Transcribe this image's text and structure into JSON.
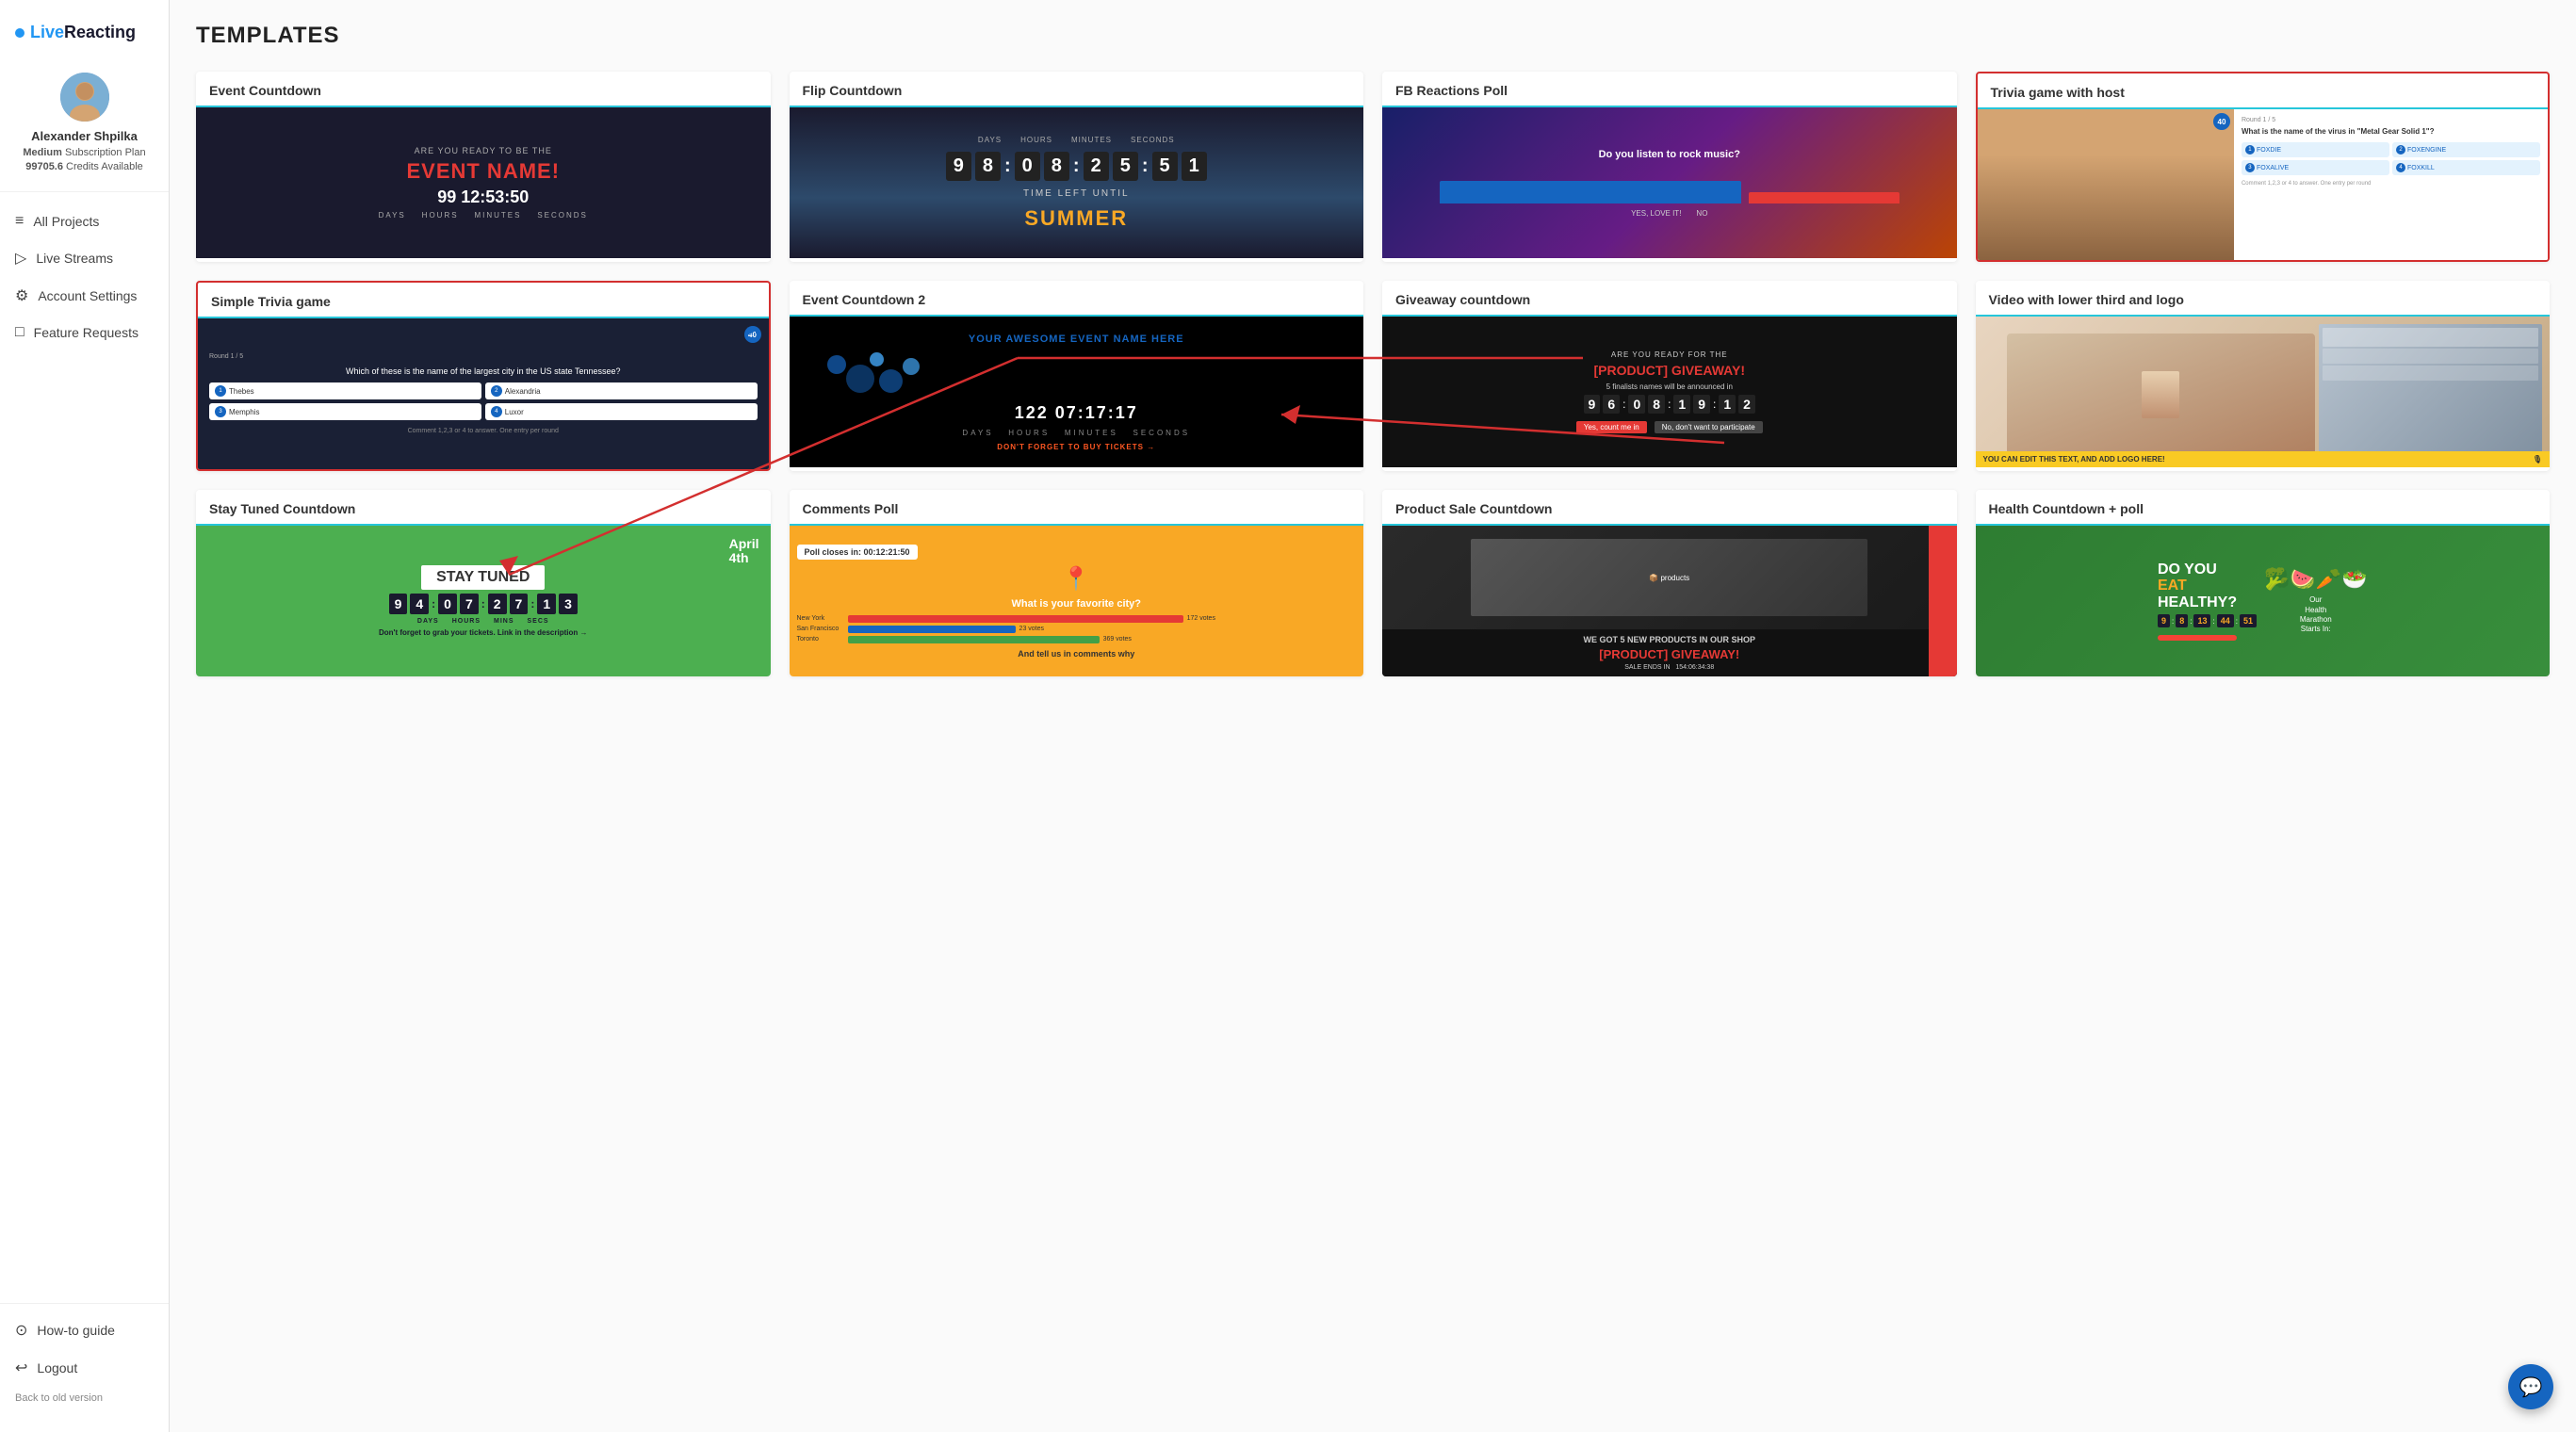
{
  "app": {
    "name": "LiveReacting",
    "logo_dot_color": "#2196f3"
  },
  "user": {
    "name": "Alexander Shpilka",
    "subscription_plan": "Medium",
    "subscription_label": "Subscription Plan",
    "credits": "99705.6",
    "credits_label": "Credits Available"
  },
  "sidebar": {
    "nav_items": [
      {
        "id": "all-projects",
        "label": "All Projects",
        "icon": "≡",
        "active": false
      },
      {
        "id": "live-streams",
        "label": "Live Streams",
        "icon": "▷",
        "active": false
      },
      {
        "id": "account-settings",
        "label": "Account Settings",
        "icon": "⚙",
        "active": false
      },
      {
        "id": "feature-requests",
        "label": "Feature Requests",
        "icon": "□",
        "active": false
      }
    ],
    "bottom_nav": [
      {
        "id": "how-to-guide",
        "label": "How-to guide",
        "icon": "?"
      },
      {
        "id": "logout",
        "label": "Logout",
        "icon": "↩"
      }
    ],
    "back_old_version": "Back to old version"
  },
  "page": {
    "title": "TEMPLATES"
  },
  "templates": [
    {
      "id": "event-countdown",
      "title": "Event Countdown",
      "highlighted": false,
      "preview_type": "event-countdown"
    },
    {
      "id": "flip-countdown",
      "title": "Flip Countdown",
      "highlighted": false,
      "preview_type": "flip-countdown"
    },
    {
      "id": "fb-reactions-poll",
      "title": "FB Reactions Poll",
      "highlighted": false,
      "preview_type": "fb-reactions"
    },
    {
      "id": "trivia-game-host",
      "title": "Trivia game with host",
      "highlighted": true,
      "preview_type": "trivia-host"
    },
    {
      "id": "simple-trivia-game",
      "title": "Simple Trivia game",
      "highlighted": true,
      "preview_type": "simple-trivia"
    },
    {
      "id": "event-countdown-2",
      "title": "Event Countdown 2",
      "highlighted": false,
      "preview_type": "event-countdown-2"
    },
    {
      "id": "giveaway-countdown",
      "title": "Giveaway countdown",
      "highlighted": false,
      "preview_type": "giveaway"
    },
    {
      "id": "video-lower-third",
      "title": "Video with lower third and logo",
      "highlighted": false,
      "preview_type": "video-lower"
    },
    {
      "id": "stay-tuned-countdown",
      "title": "Stay Tuned Countdown",
      "highlighted": false,
      "preview_type": "stay-tuned"
    },
    {
      "id": "comments-poll",
      "title": "Comments Poll",
      "highlighted": false,
      "preview_type": "comments-poll"
    },
    {
      "id": "product-sale-countdown",
      "title": "Product Sale Countdown",
      "highlighted": false,
      "preview_type": "product-sale"
    },
    {
      "id": "health-countdown-poll",
      "title": "Health Countdown + poll",
      "highlighted": false,
      "preview_type": "health-countdown"
    }
  ],
  "chat_button_icon": "💬"
}
